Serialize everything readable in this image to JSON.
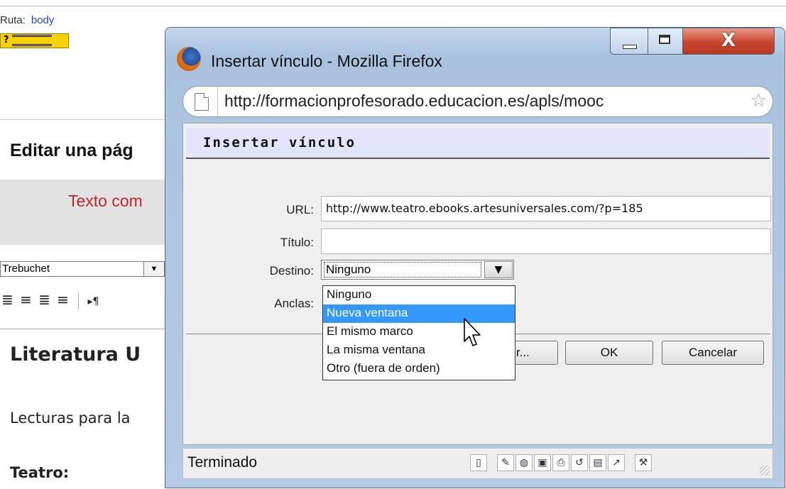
{
  "background_page": {
    "ruta_label": "Ruta:",
    "ruta_value": "body",
    "keyboard_button": "?",
    "edit_title": "Editar una pág",
    "texto_preview": "Texto com",
    "font_value": "Trebuchet",
    "lit_title": "Literatura U",
    "lecturas": "Lecturas para la",
    "teatro": "Teatro:"
  },
  "window": {
    "title": "Insertar vínculo - Mozilla Firefox",
    "url": "http://formacionprofesorado.educacion.es/apls/mooc",
    "controls": [
      "minimize-icon",
      "maximize-icon",
      "close-icon"
    ]
  },
  "dialog": {
    "title": "Insertar vínculo",
    "url_label": "URL:",
    "url_value": "http://www.teatro.ebooks.artesuniversales.com/?p=185",
    "titulo_label": "Título:",
    "titulo_value": "",
    "destino_label": "Destino:",
    "destino_value": "Ninguno",
    "anclas_label": "Anclas:",
    "destino_options": [
      "Ninguno",
      "Nueva ventana",
      "El mismo marco",
      "La misma ventana",
      "Otro (fuera de orden)"
    ],
    "highlighted_option": "Nueva ventana",
    "browse_button": "r...",
    "ok_button": "OK",
    "cancel_button": "Cancelar"
  },
  "statusbar": {
    "text": "Terminado",
    "icons": [
      "page-icon",
      "pencil-icon",
      "globe-icon",
      "save-icon",
      "print-icon",
      "refresh-icon",
      "note-icon",
      "chart-icon",
      "tools-icon"
    ]
  }
}
